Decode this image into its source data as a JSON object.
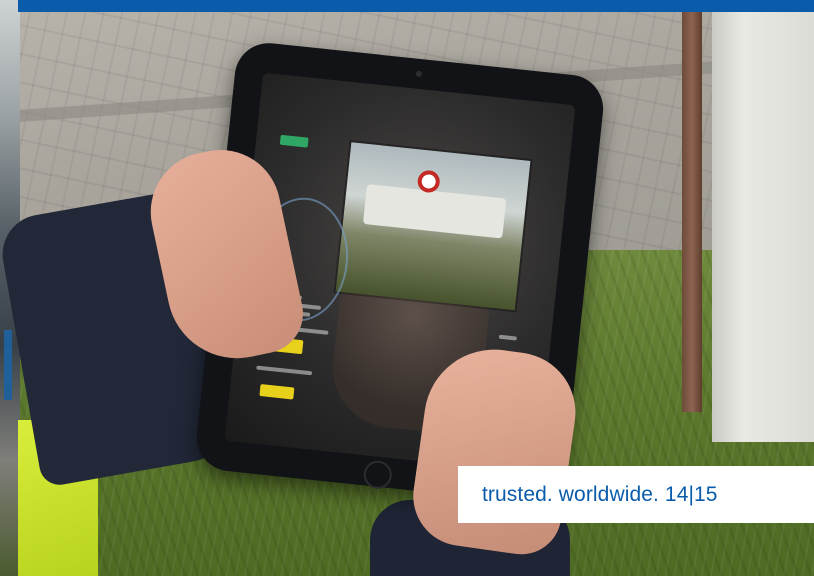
{
  "caption": {
    "text": "trusted. worldwide. 14|15"
  },
  "colors": {
    "brand_blue": "#0a5cab",
    "caption_background": "#ffffff"
  }
}
